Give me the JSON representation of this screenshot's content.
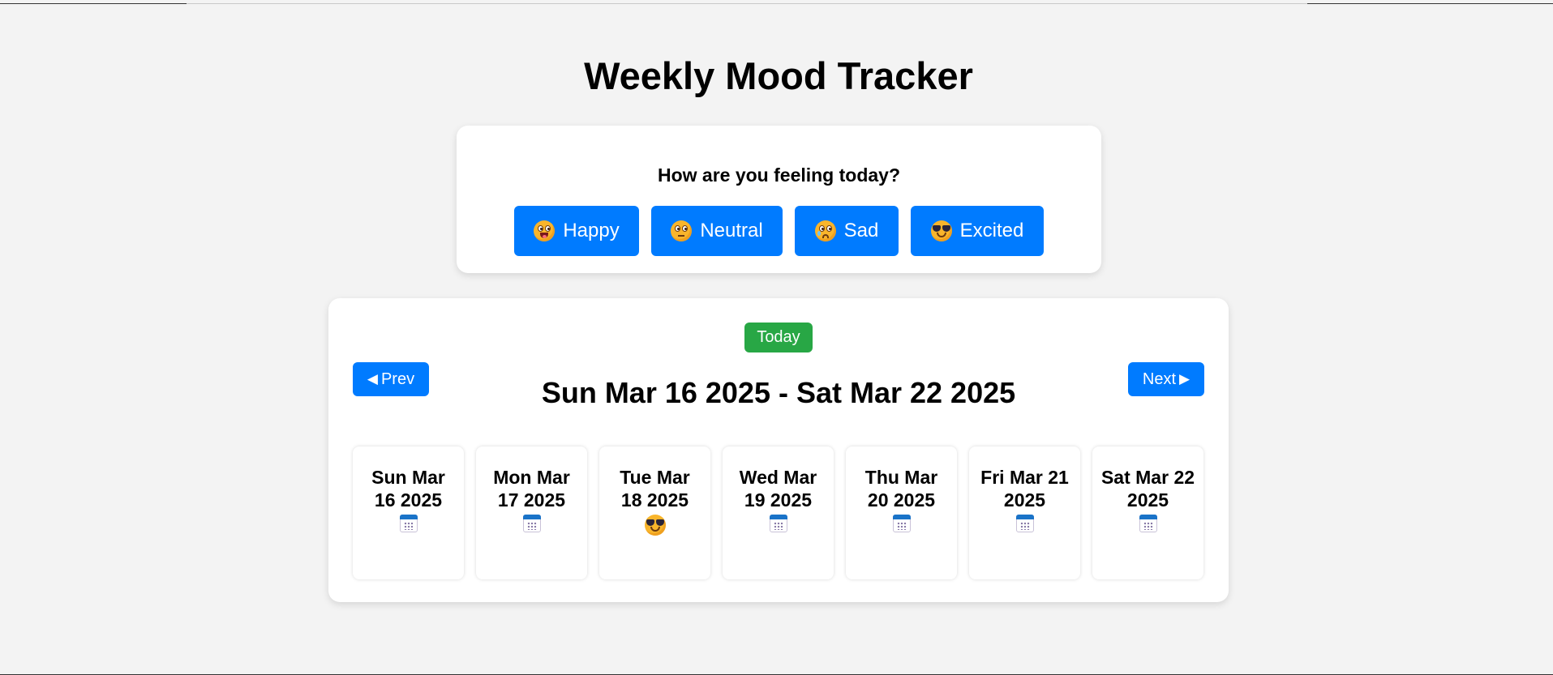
{
  "page": {
    "title": "Weekly Mood Tracker"
  },
  "mood_picker": {
    "question": "How are you feeling today?",
    "buttons": [
      {
        "label": "Happy",
        "icon": "grinning-face-icon"
      },
      {
        "label": "Neutral",
        "icon": "neutral-face-icon"
      },
      {
        "label": "Sad",
        "icon": "sad-face-icon"
      },
      {
        "label": "Excited",
        "icon": "sunglasses-face-icon"
      }
    ],
    "button_color": "#007bff"
  },
  "week_view": {
    "today_label": "Today",
    "today_color": "#28a745",
    "prev_label": "Prev",
    "prev_arrow": "◀",
    "next_label": "Next",
    "next_arrow": "▶",
    "range": "Sun Mar 16 2025 - Sat Mar 22 2025",
    "days": [
      {
        "label": "Sun Mar 16 2025",
        "mood_icon": "calendar-icon"
      },
      {
        "label": "Mon Mar 17 2025",
        "mood_icon": "calendar-icon"
      },
      {
        "label": "Tue Mar 18 2025",
        "mood_icon": "sunglasses-face-icon"
      },
      {
        "label": "Wed Mar 19 2025",
        "mood_icon": "calendar-icon"
      },
      {
        "label": "Thu Mar 20 2025",
        "mood_icon": "calendar-icon"
      },
      {
        "label": "Fri Mar 21 2025",
        "mood_icon": "calendar-icon"
      },
      {
        "label": "Sat Mar 22 2025",
        "mood_icon": "calendar-icon"
      }
    ]
  }
}
